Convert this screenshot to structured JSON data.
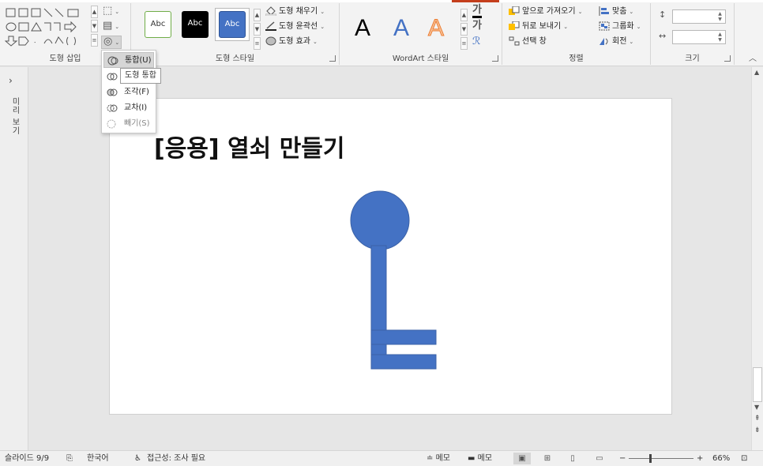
{
  "ribbon": {
    "groups": {
      "insert_shapes": {
        "label": "도형 삽입"
      },
      "shape_styles": {
        "label": "도형 스타일"
      },
      "wordart_styles": {
        "label": "WordArt 스타일"
      },
      "arrange": {
        "label": "정렬"
      },
      "size": {
        "label": "크기"
      }
    },
    "style_swatches": [
      "Abc",
      "Abc",
      "Abc"
    ],
    "shape_commands": {
      "fill": "도형 채우기",
      "outline": "도형 윤곽선",
      "effects": "도형 효과"
    },
    "wordart_letters": [
      "A",
      "A",
      "A"
    ],
    "arrange_commands": {
      "bring_forward": "앞으로 가져오기",
      "send_backward": "뒤로 보내기",
      "selection_pane": "선택 창",
      "align": "맞춤",
      "group": "그룹화",
      "rotate": "회전"
    },
    "size": {
      "height_value": "",
      "width_value": ""
    }
  },
  "merge_menu": {
    "items": [
      {
        "label": "통합(U)",
        "state": "active"
      },
      {
        "label": "",
        "state": "normal"
      },
      {
        "label": "조각(F)",
        "state": "normal"
      },
      {
        "label": "교차(I)",
        "state": "normal"
      },
      {
        "label": "빼기(S)",
        "state": "disabled"
      }
    ],
    "tooltip": "도형 통합"
  },
  "thumb_strip": {
    "label": "미리 보기"
  },
  "slide": {
    "title": "[응용] 열쇠 만들기",
    "key_color": "#4472c4"
  },
  "statusbar": {
    "slide_info": "슬라이드 9/9",
    "language": "한국어",
    "accessibility": "접근성: 조사 필요",
    "notes": "메모",
    "comments": "메모",
    "zoom": "66%",
    "zoom_fraction": 0.33
  },
  "colors": {
    "accent": "#c43e1c",
    "ribbon_bg": "#f3f3f3",
    "canvas_bg": "#e6e6e6"
  }
}
